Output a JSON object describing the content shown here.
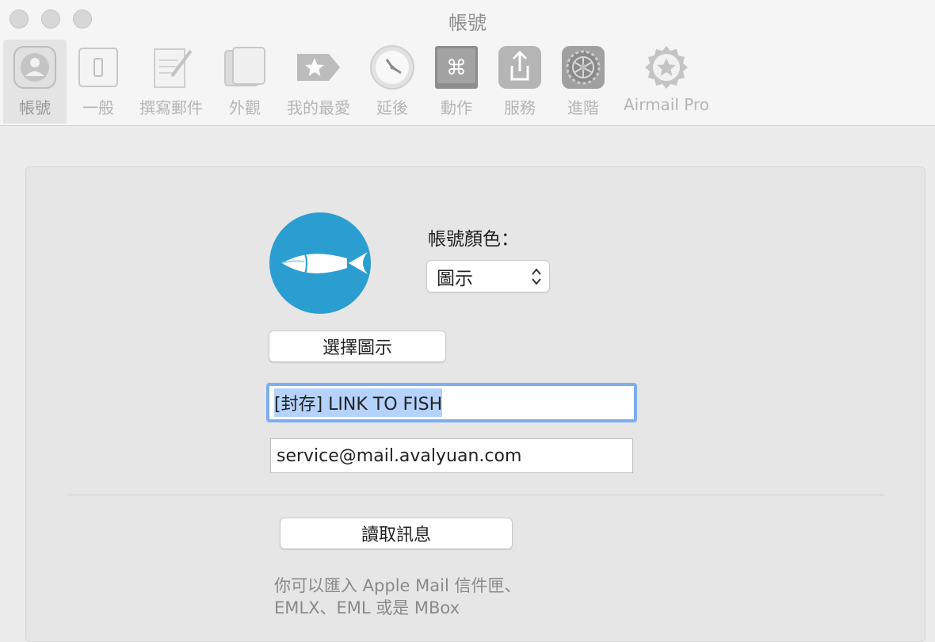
{
  "window": {
    "title": "帳號"
  },
  "toolbar": {
    "items": [
      {
        "label": "帳號",
        "icon": "account-icon"
      },
      {
        "label": "一般",
        "icon": "switch-icon"
      },
      {
        "label": "撰寫郵件",
        "icon": "compose-icon"
      },
      {
        "label": "外觀",
        "icon": "appearance-icon"
      },
      {
        "label": "我的最愛",
        "icon": "favorite-tag-icon"
      },
      {
        "label": "延後",
        "icon": "clock-icon"
      },
      {
        "label": "動作",
        "icon": "command-icon"
      },
      {
        "label": "服務",
        "icon": "share-icon"
      },
      {
        "label": "進階",
        "icon": "gear-icon"
      },
      {
        "label": "Airmail Pro",
        "icon": "star-badge-icon"
      }
    ]
  },
  "account": {
    "color_label": "帳號顏色：",
    "color_value": "圖示",
    "choose_icon_label": "選擇圖示",
    "name_value": "[封存] LINK TO FISH",
    "email_value": "service@mail.avalyuan.com",
    "read_messages_label": "讀取訊息",
    "import_hint_line1": "你可以匯入 Apple Mail 信件匣、",
    "import_hint_line2": "EMLX、EML 或是 MBox"
  },
  "colors": {
    "accent": "#2b9ed1",
    "focus_ring": "#7eadf0",
    "selection": "#b4d2fb"
  }
}
